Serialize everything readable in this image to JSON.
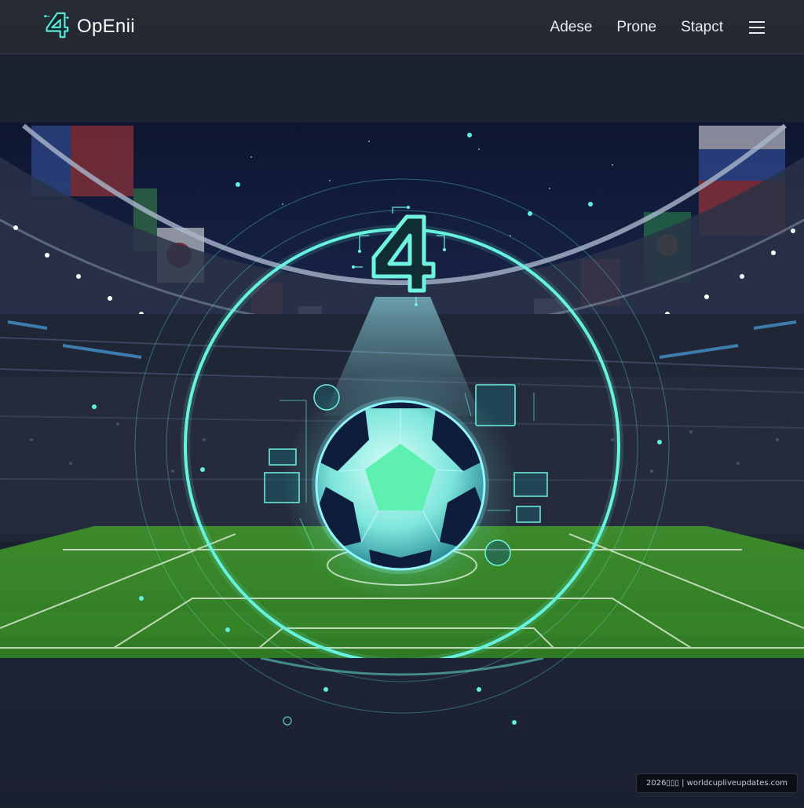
{
  "header": {
    "brand_name": "OpEnii",
    "logo_icon": "digital-4-logo-icon",
    "nav": [
      {
        "label": "Adese"
      },
      {
        "label": "Prone"
      },
      {
        "label": "Stapct"
      }
    ],
    "menu_icon": "hamburger-menu-icon"
  },
  "hero": {
    "scene": "stadium-hologram",
    "emblem_icon": "circuit-4-emblem-icon",
    "ball_icon": "holographic-soccer-ball-icon"
  },
  "footer": {
    "caption": "2026▯▯▯ | worldcupliveupdates.com"
  },
  "colors": {
    "accent": "#5ff0dc",
    "header_bg": "#252a33",
    "page_bg": "#1c2130",
    "pitch": "#3f8f2f"
  }
}
